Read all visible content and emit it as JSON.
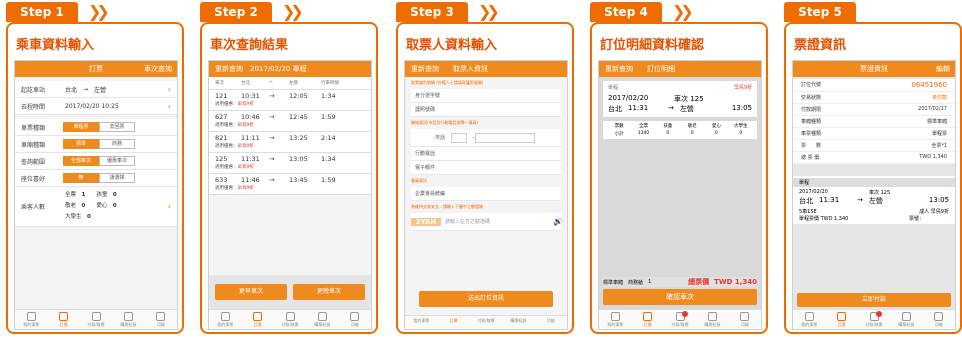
{
  "steps": [
    {
      "tab": "Step 1",
      "title": "乘車資料輸入"
    },
    {
      "tab": "Step 2",
      "title": "車次查詢結果"
    },
    {
      "tab": "Step 3",
      "title": "取票人資料輸入"
    },
    {
      "tab": "Step 4",
      "title": "訂位明細資料確認"
    },
    {
      "tab": "Step 5",
      "title": "票證資訊"
    }
  ],
  "nav": [
    "我的車票",
    "訂票",
    "付款/取票",
    "購票紀錄",
    "功能"
  ],
  "s1": {
    "tab_a": "訂票",
    "tab_b": "車次查詢",
    "lb_station": "起訖車站",
    "from": "台北",
    "to": "左營",
    "arrow": "→",
    "lb_time": "去程時間",
    "time": "2017/02/20 10:25",
    "lb_type": "車票種類",
    "type_a": "單程票",
    "type_b": "去回票",
    "lb_car": "車廂種類",
    "car_a": "標準",
    "car_b": "商務",
    "lb_range": "查詢範圍",
    "range_a": "全部車次",
    "range_b": "優惠車次",
    "lb_seat": "座位喜好",
    "seat_a": "無",
    "seat_b": "請選擇",
    "lb_count": "乘客人數",
    "full": "全票",
    "full_n": "1",
    "child": "孩童",
    "child_n": "0",
    "senior": "敬老",
    "senior_n": "0",
    "love": "愛心",
    "love_n": "0",
    "student": "大學生",
    "student_n": "0",
    "chev": "›"
  },
  "s2": {
    "hdr_a": "重新查詢",
    "hdr_b": "2017/02/20 單程",
    "col1": "車次",
    "col2": "台北",
    "col3": "→",
    "col4": "左營",
    "col5": "行車時間",
    "trains": [
      {
        "no": "121",
        "dep": "10:31",
        "arr": "12:05",
        "dur": "1:34",
        "note": "適用優惠：",
        "disc": "早鳥9折"
      },
      {
        "no": "627",
        "dep": "10:46",
        "arr": "12:45",
        "dur": "1:59",
        "note": "適用優惠：",
        "disc": "早鳥9折"
      },
      {
        "no": "821",
        "dep": "11:11",
        "arr": "13:25",
        "dur": "2:14",
        "note": "適用優惠：",
        "disc": "早鳥9折"
      },
      {
        "no": "125",
        "dep": "11:31",
        "arr": "13:05",
        "dur": "1:34",
        "note": "適用優惠：",
        "disc": "早鳥9折"
      },
      {
        "no": "633",
        "dep": "11:46",
        "arr": "13:45",
        "dur": "1:59",
        "note": "適用優惠：",
        "disc": "早鳥9折"
      }
    ],
    "btn_a": "更早車次",
    "btn_b": "更晚車次"
  },
  "s3": {
    "hdr_a": "重新查詢",
    "hdr_b": "取票人資訊",
    "sec1": "取票識別號碼 (外籍人士請填寫護照號碼)",
    "id": "身分證字號",
    "pass": "護照號碼",
    "sec2": "聯絡資訊(市話及行動電話須擇一填寫)",
    "tel": "市話",
    "mobile": "行動電話",
    "email": "電子郵件",
    "sec3": "會員資訊",
    "corp": "企業會員統編",
    "sec4": "為維持交易安全，請輸入下圖中之驗證碼",
    "captcha": "2YAH",
    "captcha_ph": "請輸入左方之驗證碼",
    "submit": "送出訂位資訊"
  },
  "s4": {
    "hdr_a": "重新查詢",
    "hdr_b": "訂位明細",
    "trip": "單程",
    "disc": "早鳥9折",
    "date": "2017/02/20",
    "train": "車次 125",
    "from": "台北",
    "dep": "11:31",
    "to": "左營",
    "arr": "13:05",
    "th": [
      "票數",
      "全票",
      "孩童",
      "敬老",
      "愛心",
      "大學生"
    ],
    "row1": [
      "1",
      "0",
      "0",
      "0",
      "0"
    ],
    "sub": "小計",
    "sub_v": [
      "1340",
      "0",
      "0",
      "0",
      "0"
    ],
    "car": "標準車廂",
    "seat_lb": "商務艙",
    "seat_n": "1",
    "total_lb": "總票價",
    "total": "TWD 1,340",
    "confirm": "確認車次"
  },
  "s5": {
    "hdr_a": "票證資訊",
    "hdr_b": "編輯",
    "code_lb": "訂位代號",
    "code": "06451960",
    "status_lb": "交易狀態",
    "status": "未付款",
    "pay_lb": "付款期限",
    "pay": "2017/02/17",
    "car_lb": "車廂種類",
    "car": "標準車廂",
    "type_lb": "車票種類",
    "type": "單程票",
    "cnt_lb": "票　　數",
    "cnt": "全票*1",
    "total_lb": "總 票 價",
    "total": "TWD 1,340",
    "trip": "單程",
    "date": "2017/02/20",
    "train": "車次 125",
    "from": "台北",
    "dep": "11:31",
    "to": "左營",
    "arr": "13:05",
    "seat": "5車15E",
    "price_lb": "單程票價 TWD 1,340",
    "adult": "成人 早鳥9折",
    "ticket_lb": "票號：",
    "pay_btn": "立即付款"
  }
}
